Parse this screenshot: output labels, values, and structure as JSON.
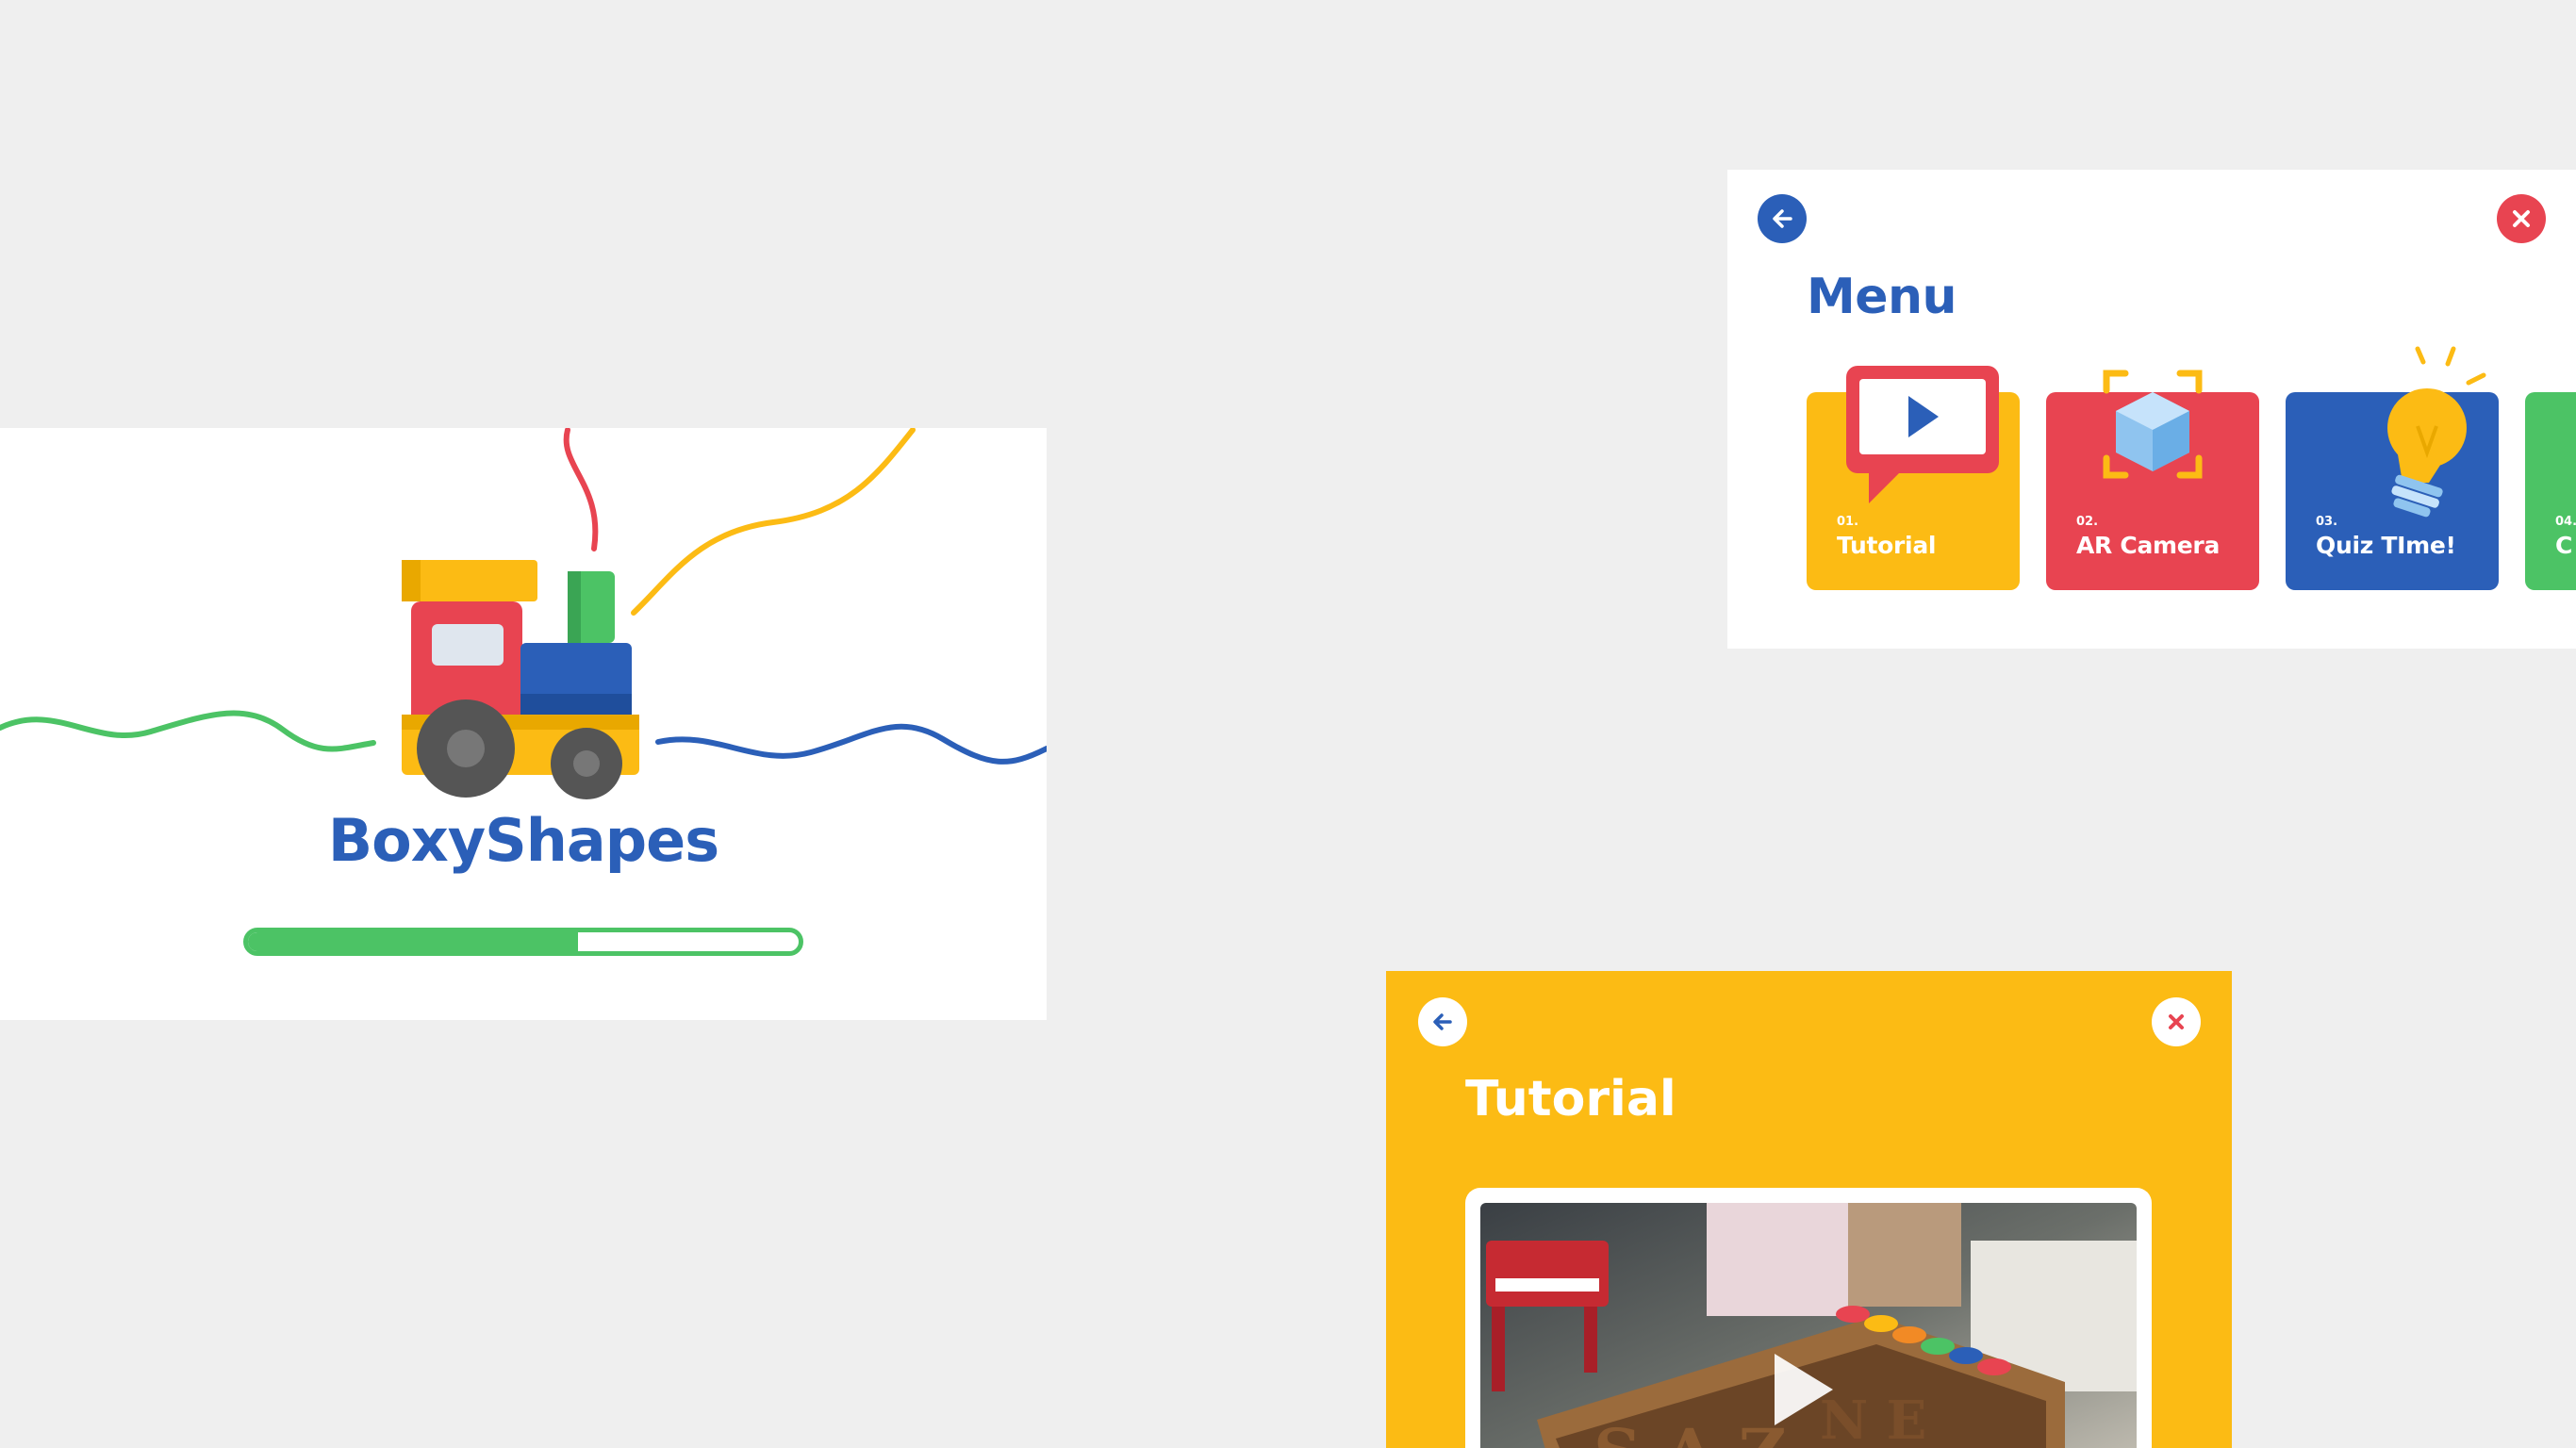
{
  "splash": {
    "app_name": "BoxyShapes",
    "loading_progress": 0.6,
    "illustration": "toy-train"
  },
  "menu": {
    "title": "Menu",
    "back_icon": "arrow-left-icon",
    "close_icon": "close-icon",
    "cards": [
      {
        "number": "01.",
        "label": "Tutorial",
        "color": "#fcbb14",
        "icon": "video-play-icon"
      },
      {
        "number": "02.",
        "label": "AR Camera",
        "color": "#e84451",
        "icon": "ar-cube-icon"
      },
      {
        "number": "03.",
        "label": "Quiz TIme!",
        "color": "#2b5fb8",
        "icon": "lightbulb-icon"
      },
      {
        "number": "04.",
        "label": "C",
        "color": "#4cc365",
        "icon": ""
      }
    ]
  },
  "tutorial": {
    "title": "Tutorial",
    "back_icon": "arrow-left-icon",
    "close_icon": "close-icon",
    "video_icon": "play-icon"
  },
  "colors": {
    "blue": "#2b5fb8",
    "red": "#e84451",
    "yellow": "#fcbb14",
    "green": "#4cc365",
    "background": "#efefef"
  }
}
